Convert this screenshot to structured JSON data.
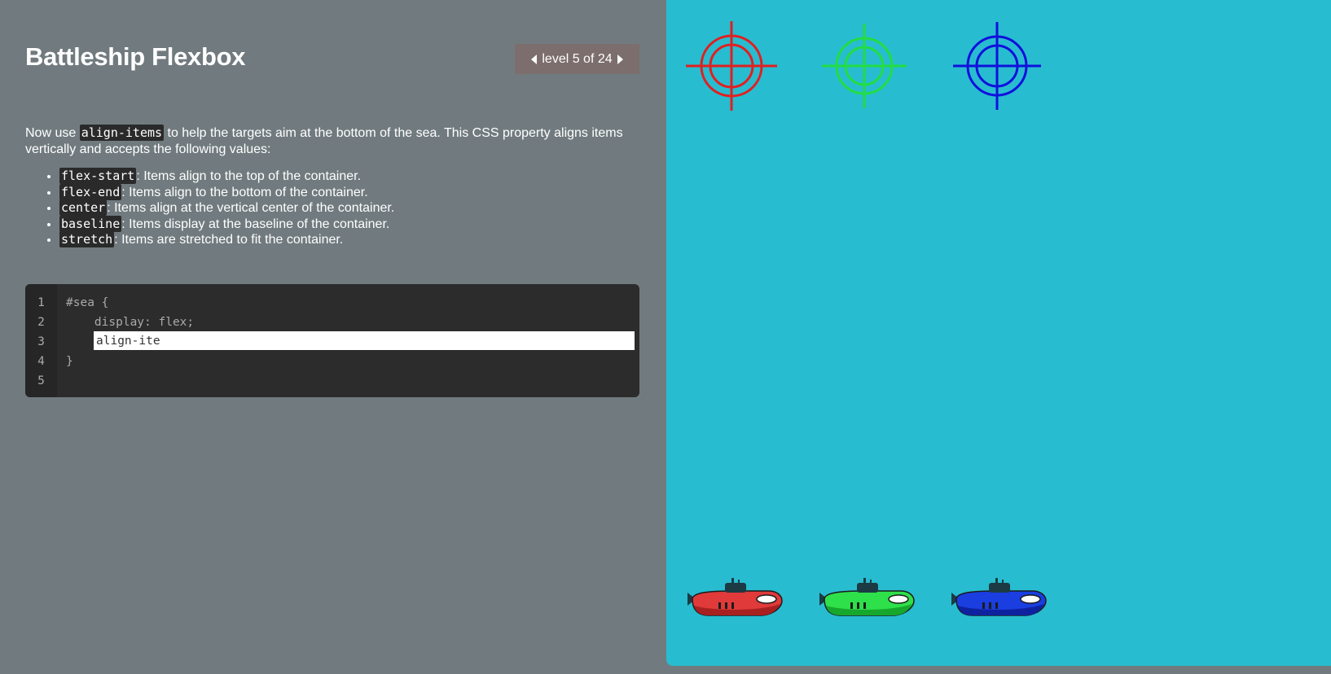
{
  "header": {
    "title": "Battleship Flexbox",
    "level_label": "level 5 of 24"
  },
  "instructions": {
    "intro_before": "Now use ",
    "intro_code": "align-items",
    "intro_after": " to help the targets aim at the bottom of the sea. This CSS property aligns items vertically and accepts the following values:",
    "values": [
      {
        "code": "flex-start",
        "text": ": Items align to the top of the container."
      },
      {
        "code": "flex-end",
        "text": ": Items align to the bottom of the container."
      },
      {
        "code": "center",
        "text": ": Items align at the vertical center of the container."
      },
      {
        "code": "baseline",
        "text": ": Items display at the baseline of the container."
      },
      {
        "code": "stretch",
        "text": ": Items are stretched to fit the container."
      }
    ]
  },
  "editor": {
    "line_numbers": [
      "1",
      "2",
      "3",
      "4",
      "5"
    ],
    "line1": "#sea {",
    "line2": "    display: flex;",
    "input_value": "align-ite",
    "line4": "}",
    "line5": ""
  },
  "board": {
    "targets": [
      {
        "name": "target-red",
        "color": "#e02020"
      },
      {
        "name": "target-green",
        "color": "#22dd44"
      },
      {
        "name": "target-blue",
        "color": "#1010dd"
      }
    ],
    "submarines": [
      {
        "name": "submarine-red",
        "color": "#e03a3a"
      },
      {
        "name": "submarine-green",
        "color": "#2ee04a"
      },
      {
        "name": "submarine-blue",
        "color": "#1a3ee0"
      }
    ],
    "sea_color": "#28bcd0"
  },
  "colors": {
    "panel_bg": "#717b7f",
    "editor_bg": "#2c2c2c",
    "nav_bg": "#7b6e6c"
  }
}
